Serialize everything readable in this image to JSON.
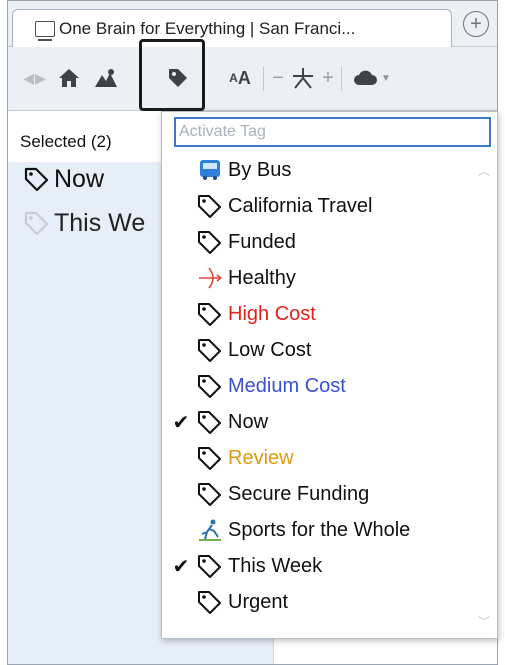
{
  "tab": {
    "title": "One Brain for Everything | San Franci...",
    "new_tab_icon": "plus-circle-icon"
  },
  "toolbar": {
    "items": [
      "back-forward-icon",
      "home-icon",
      "map-icon",
      "tag-icon",
      "font-size-icon",
      "zoom-out",
      "graph-icon",
      "zoom-in",
      "cloud-icon"
    ],
    "font_label": "AA",
    "minus": "−",
    "plus": "+"
  },
  "left_pane": {
    "selected_label": "Selected (2)",
    "selected_tags": [
      "Now",
      "This We"
    ]
  },
  "dropdown": {
    "search_placeholder": "Activate Tag",
    "items": [
      {
        "label": "By Bus",
        "icon": "bus-icon",
        "color": "#111111",
        "checked": false
      },
      {
        "label": "California Travel",
        "icon": "tag-icon",
        "color": "#111111",
        "checked": false
      },
      {
        "label": "Funded",
        "icon": "tag-icon",
        "color": "#111111",
        "checked": false
      },
      {
        "label": "Healthy",
        "icon": "bow-arrow-icon",
        "color": "#111111",
        "checked": false
      },
      {
        "label": "High Cost",
        "icon": "tag-icon",
        "color": "#e0241b",
        "checked": false
      },
      {
        "label": "Low Cost",
        "icon": "tag-icon",
        "color": "#111111",
        "checked": false
      },
      {
        "label": "Medium Cost",
        "icon": "tag-icon",
        "color": "#3b4fd1",
        "checked": false
      },
      {
        "label": "Now",
        "icon": "tag-icon",
        "color": "#111111",
        "checked": true
      },
      {
        "label": "Review",
        "icon": "tag-icon",
        "color": "#e09a12",
        "checked": false
      },
      {
        "label": "Secure Funding",
        "icon": "tag-icon",
        "color": "#111111",
        "checked": false
      },
      {
        "label": "Sports for the Whole",
        "icon": "runner-icon",
        "color": "#111111",
        "checked": false
      },
      {
        "label": "This Week",
        "icon": "tag-icon",
        "color": "#111111",
        "checked": true
      },
      {
        "label": "Urgent",
        "icon": "tag-icon",
        "color": "#111111",
        "checked": false
      }
    ],
    "check_glyph": "✔"
  }
}
